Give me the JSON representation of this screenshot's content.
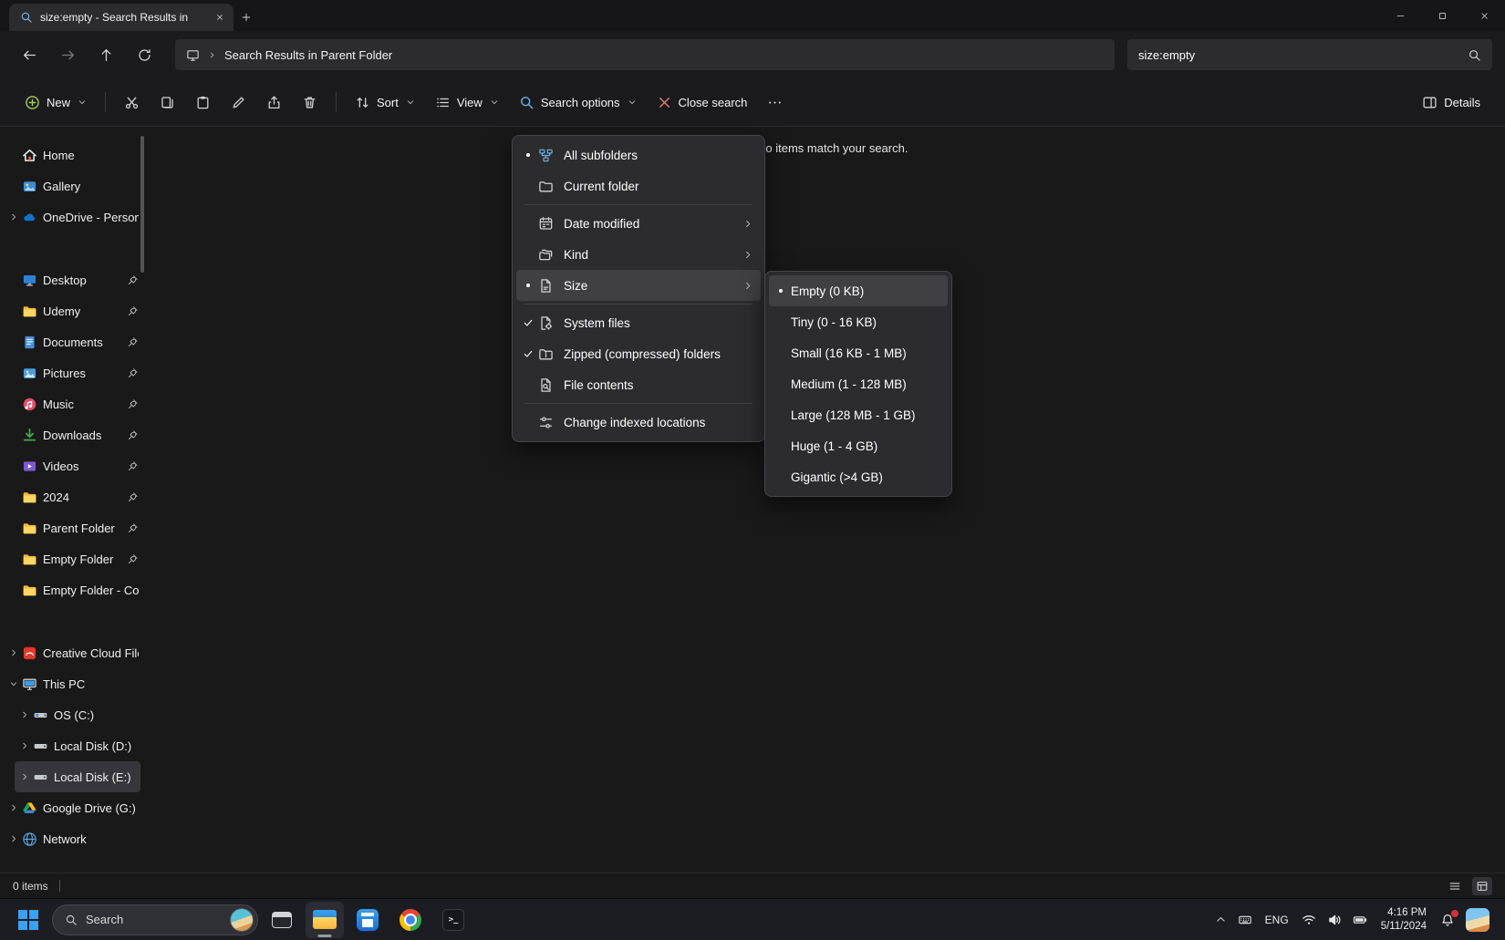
{
  "colors": {
    "accent_blue": "#3ba1f2",
    "menu_bg": "#2c2c2e",
    "highlight": "#404043",
    "close_x_red": "#e8826f"
  },
  "titlebar": {
    "tab_title": "size:empty - Search Results in"
  },
  "navbar": {
    "breadcrumb": "Search Results in Parent Folder",
    "search_value": "size:empty"
  },
  "toolbar": {
    "new_label": "New",
    "sort_label": "Sort",
    "view_label": "View",
    "search_options_label": "Search options",
    "close_search_label": "Close search",
    "details_label": "Details"
  },
  "sidebar": {
    "items": [
      {
        "label": "Home",
        "icon": "home"
      },
      {
        "label": "Gallery",
        "icon": "gallery"
      },
      {
        "label": "OneDrive - Personal",
        "icon": "onedrive",
        "chevron": "right"
      },
      {
        "label": "Desktop",
        "icon": "desktop",
        "pin": true,
        "gap": true
      },
      {
        "label": "Udemy",
        "icon": "folder",
        "pin": true
      },
      {
        "label": "Documents",
        "icon": "documents",
        "pin": true
      },
      {
        "label": "Pictures",
        "icon": "pictures",
        "pin": true
      },
      {
        "label": "Music",
        "icon": "music",
        "pin": true
      },
      {
        "label": "Downloads",
        "icon": "downloads",
        "pin": true
      },
      {
        "label": "Videos",
        "icon": "videos",
        "pin": true
      },
      {
        "label": "2024",
        "icon": "folder",
        "pin": true
      },
      {
        "label": "Parent Folder",
        "icon": "folder",
        "pin": true
      },
      {
        "label": "Empty Folder",
        "icon": "folder",
        "pin": true
      },
      {
        "label": "Empty Folder - Copy",
        "icon": "folder"
      },
      {
        "label": "Creative Cloud Files",
        "icon": "creative-cloud",
        "chevron": "right",
        "gap": true
      },
      {
        "label": "This PC",
        "icon": "this-pc",
        "chevron": "down"
      },
      {
        "label": "OS (C:)",
        "icon": "drive-os",
        "chevron": "right",
        "indent": true
      },
      {
        "label": "Local Disk (D:)",
        "icon": "drive",
        "chevron": "right",
        "indent": true
      },
      {
        "label": "Local Disk (E:)",
        "icon": "drive",
        "chevron": "right",
        "indent": true,
        "selected": true
      },
      {
        "label": "Google Drive (G:)",
        "icon": "google-drive",
        "chevron": "right"
      },
      {
        "label": "Network",
        "icon": "network",
        "chevron": "right"
      }
    ]
  },
  "content": {
    "empty_message": "No items match your search."
  },
  "menus": {
    "search_options": {
      "items": [
        {
          "label": "All subfolders",
          "icon": "subfolders",
          "state": "radio"
        },
        {
          "label": "Current folder",
          "icon": "current-folder"
        },
        {
          "sep": true
        },
        {
          "label": "Date modified",
          "icon": "date-modified",
          "submenu": true
        },
        {
          "label": "Kind",
          "icon": "kind",
          "submenu": true
        },
        {
          "label": "Size",
          "icon": "size-file",
          "state": "radio",
          "submenu": true,
          "highlighted": true
        },
        {
          "sep": true
        },
        {
          "label": "System files",
          "icon": "system-files",
          "state": "check"
        },
        {
          "label": "Zipped (compressed) folders",
          "icon": "zipped",
          "state": "check"
        },
        {
          "label": "File contents",
          "icon": "file-contents"
        },
        {
          "sep": true
        },
        {
          "label": "Change indexed locations",
          "icon": "indexed-locations"
        }
      ]
    },
    "size_submenu": {
      "items": [
        {
          "label": "Empty (0 KB)",
          "state": "radio",
          "highlighted": true
        },
        {
          "label": "Tiny (0 - 16 KB)"
        },
        {
          "label": "Small (16 KB - 1 MB)"
        },
        {
          "label": "Medium (1 - 128 MB)"
        },
        {
          "label": "Large (128 MB - 1 GB)"
        },
        {
          "label": "Huge (1 - 4 GB)"
        },
        {
          "label": "Gigantic (>4 GB)"
        }
      ]
    }
  },
  "statusbar": {
    "items_count": "0 items"
  },
  "taskbar": {
    "search_label": "Search",
    "tray": {
      "lang": "ENG",
      "time": "4:16 PM",
      "date": "5/11/2024"
    }
  }
}
